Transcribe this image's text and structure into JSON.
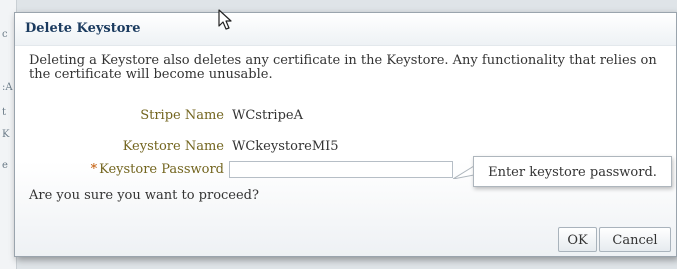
{
  "background": {
    "chars": [
      "c",
      ":A",
      "t",
      "K",
      "e"
    ]
  },
  "dialog": {
    "title": "Delete Keystore",
    "message": "Deleting a Keystore also deletes any certificate in the Keystore. Any functionality that relies on the certificate will become unusable.",
    "stripe_label": "Stripe Name",
    "stripe_value": "WCstripeA",
    "keystore_label": "Keystore Name",
    "keystore_value": "WCkeystoreMI5",
    "password_required_marker": "*",
    "password_label": "Keystore Password",
    "password_value": "",
    "tooltip": "Enter keystore password.",
    "confirm_text": "Are you sure you want to proceed?",
    "ok_label": "OK",
    "cancel_label": "Cancel"
  },
  "icons": {
    "cursor": "mouse-pointer-icon"
  }
}
